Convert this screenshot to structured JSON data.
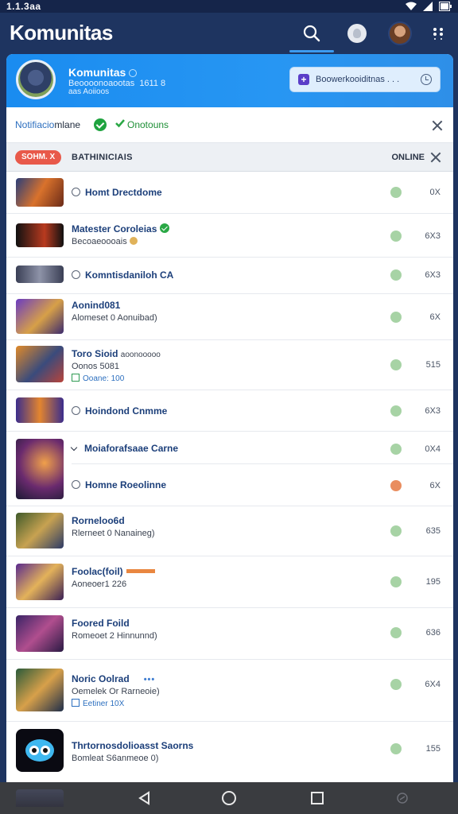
{
  "status_bar": {
    "time": "1.1.3aa"
  },
  "app": {
    "title": "Komunitas"
  },
  "profile": {
    "name": "Komunitas",
    "subtitle": "Beoooonoaootas",
    "meta": "1611 8",
    "meta2": "aas Aoiioos",
    "action_label": "Boowerkooiditnas . . ."
  },
  "notification": {
    "label": "Notifiacio",
    "label2": "mlane",
    "status": "Onotouns"
  },
  "list_header": {
    "tag": "SOHM. X",
    "title": "BATHINICIAIS",
    "online": "ONLINE"
  },
  "rows": [
    {
      "title": "Homt Drectdome",
      "sub": "",
      "extra": "",
      "count": "0X",
      "status": "green"
    },
    {
      "title": "Matester Coroleias",
      "sub": "Becoaeoooais",
      "extra": "",
      "count": "6X3",
      "status": "green"
    },
    {
      "title": "Komntisdaniloh CA",
      "sub": "",
      "extra": "",
      "count": "6X3",
      "status": "green"
    },
    {
      "title": "Aonind081",
      "sub": "Alomeset 0 Aonuibad)",
      "extra": "",
      "count": "6X",
      "status": "green"
    },
    {
      "title": "Toro Sioid",
      "title_suffix": "aoonooooo",
      "sub": "Oonos 5081",
      "extra": "Ooane: 100",
      "count": "515",
      "status": "green"
    },
    {
      "title": "Hoindond Cnmme",
      "sub": "",
      "extra": "",
      "count": "6X3",
      "status": "green"
    },
    {
      "title": "Moiaforafsaae Carne",
      "sub": "",
      "extra": "",
      "count": "0X4",
      "status": "green"
    },
    {
      "title": "Homne Roeolinne",
      "sub": "",
      "extra": "",
      "count": "6X",
      "status": "orange"
    },
    {
      "title": "Rorneloo6d",
      "sub": "Rlerneet 0 Nanaineg)",
      "extra": "",
      "count": "635",
      "status": "green"
    },
    {
      "title": "Foolac(foil)",
      "sub": "Aoneoer1 226",
      "extra": "",
      "count": "195",
      "status": "green"
    },
    {
      "title": "Foored Foild",
      "sub": "Romeoet 2 Hinnunnd)",
      "extra": "",
      "count": "636",
      "status": "green"
    },
    {
      "title": "Noric Oolrad",
      "sub": "Oemelek Or Rarneoie)",
      "extra": "Eetiner 10X",
      "count": "6X4",
      "status": "green"
    },
    {
      "title": "Thrtornosdolioasst Saorns",
      "sub": "Bomleat S6anmeoe 0)",
      "extra": "",
      "count": "155",
      "status": "green"
    }
  ],
  "colors": {
    "app_bar": "#1e3460",
    "accent_blue": "#2796f3",
    "header_tag": "#e8594a",
    "link_title": "#1c3f7a",
    "online_green": "#a7d3a5"
  },
  "icons": {
    "search": "search-icon",
    "notification": "badge-icon",
    "menu": "more-vertical-icon",
    "back": "back-triangle-icon",
    "home": "home-circle-icon",
    "recent": "recent-square-icon"
  }
}
